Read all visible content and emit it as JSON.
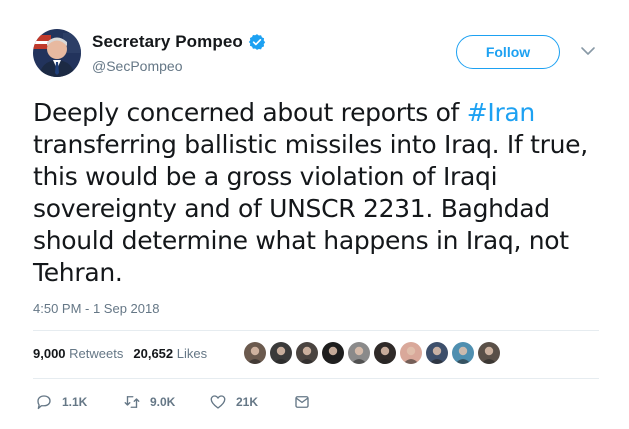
{
  "user": {
    "display_name": "Secretary Pompeo",
    "handle": "@SecPompeo",
    "verified": true
  },
  "follow_button": {
    "label": "Follow"
  },
  "tweet": {
    "text_before": "Deeply concerned about reports of ",
    "hashtag": "#Iran",
    "text_after": " transferring ballistic missiles into Iraq. If true, this would be a gross violation of Iraqi sovereignty and of UNSCR 2231. Baghdad should determine what happens in Iraq, not Tehran.",
    "timestamp": "4:50 PM - 1 Sep 2018"
  },
  "stats": {
    "retweets_count": "9,000",
    "retweets_label": "Retweets",
    "likes_count": "20,652",
    "likes_label": "Likes"
  },
  "likers": [
    {
      "name": "liker-avatar-1",
      "color": "#6b5a4e"
    },
    {
      "name": "liker-avatar-2",
      "color": "#3a3a3a"
    },
    {
      "name": "liker-avatar-3",
      "color": "#4a4440"
    },
    {
      "name": "liker-avatar-4",
      "color": "#1e1e1e"
    },
    {
      "name": "liker-avatar-5",
      "color": "#8a8a8a"
    },
    {
      "name": "liker-avatar-6",
      "color": "#2f2a28"
    },
    {
      "name": "liker-avatar-7",
      "color": "#d9a89a"
    },
    {
      "name": "liker-avatar-8",
      "color": "#3d4f6b"
    },
    {
      "name": "liker-avatar-9",
      "color": "#4f8fb0"
    },
    {
      "name": "liker-avatar-10",
      "color": "#5a5048"
    }
  ],
  "actions": {
    "replies": "1.1K",
    "retweets": "9.0K",
    "likes": "21K"
  },
  "colors": {
    "accent": "#1da1f2",
    "text_primary": "#14171a",
    "text_secondary": "#657786",
    "divider": "#e6ecf0"
  }
}
